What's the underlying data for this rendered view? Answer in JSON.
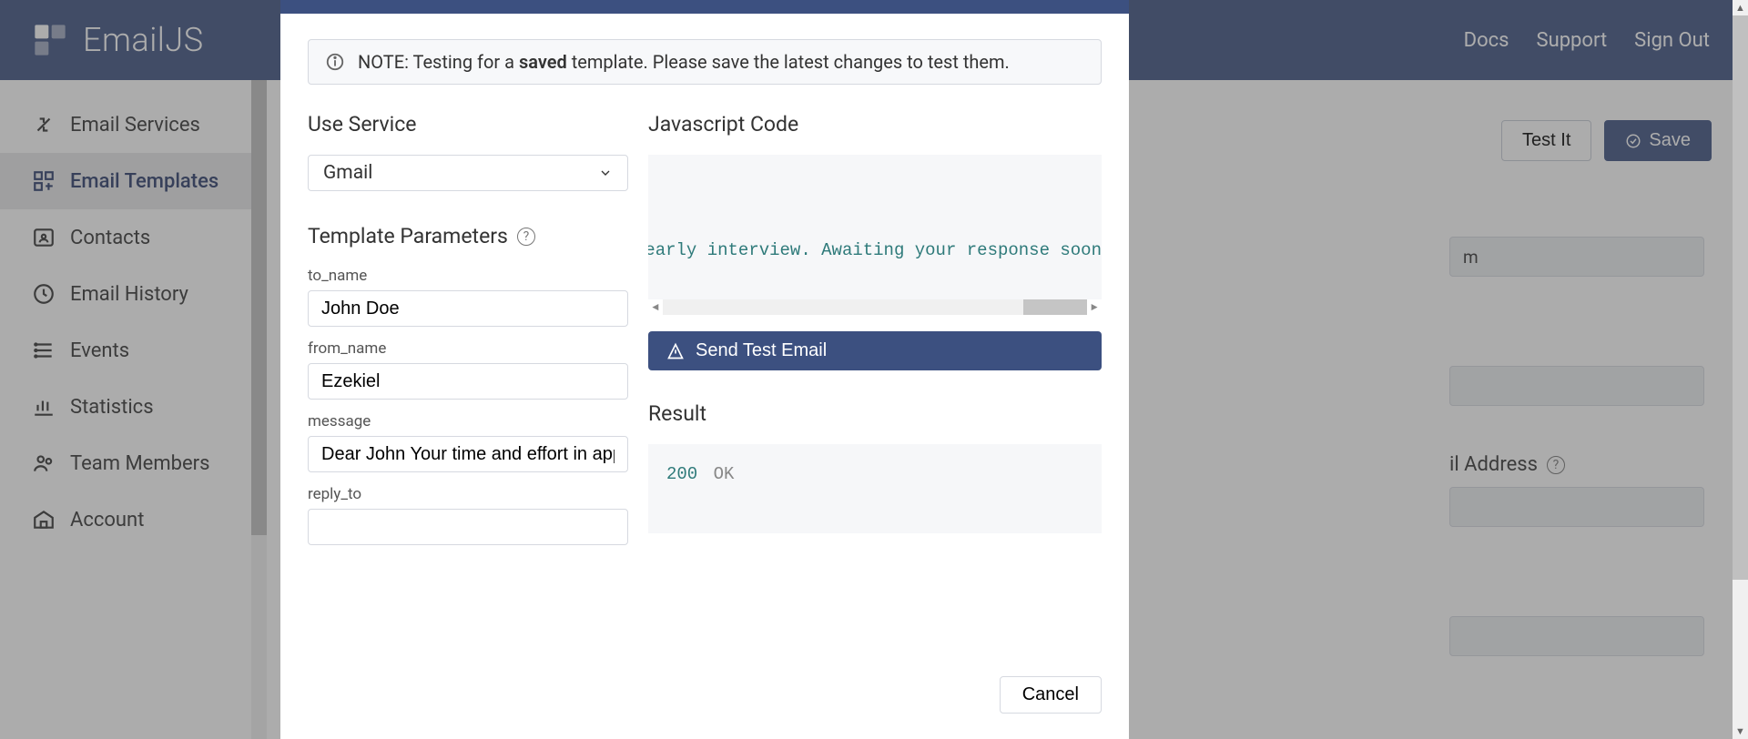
{
  "brand": "EmailJS",
  "nav": {
    "docs": "Docs",
    "support": "Support",
    "signout": "Sign Out"
  },
  "sidebar": {
    "items": [
      {
        "label": "Email Services"
      },
      {
        "label": "Email Templates"
      },
      {
        "label": "Contacts"
      },
      {
        "label": "Email History"
      },
      {
        "label": "Events"
      },
      {
        "label": "Statistics"
      },
      {
        "label": "Team Members"
      },
      {
        "label": "Account"
      }
    ]
  },
  "toolbar": {
    "test_it": "Test It",
    "save": "Save"
  },
  "bg_fields": {
    "placeholder_m": "m",
    "email_label": "il Address"
  },
  "modal": {
    "note_prefix": "NOTE: Testing for a ",
    "note_bold": "saved",
    "note_suffix": " template. Please save the latest changes to test them.",
    "use_service": "Use Service",
    "service_value": "Gmail",
    "template_params": "Template Parameters",
    "params": {
      "to_name": {
        "label": "to_name",
        "value": "John Doe"
      },
      "from_name": {
        "label": "from_name",
        "value": "Ezekiel"
      },
      "message": {
        "label": "message",
        "value": "Dear John Your time and effort in applying is well appreciated"
      },
      "reply_to": {
        "label": "reply_to",
        "value": ""
      }
    },
    "js_code": "Javascript Code",
    "code_snippet": "dule an early interview. Awaiting your response soon",
    "send_test": "Send Test Email",
    "result_label": "Result",
    "result_code": "200",
    "result_text": "OK",
    "cancel": "Cancel"
  }
}
